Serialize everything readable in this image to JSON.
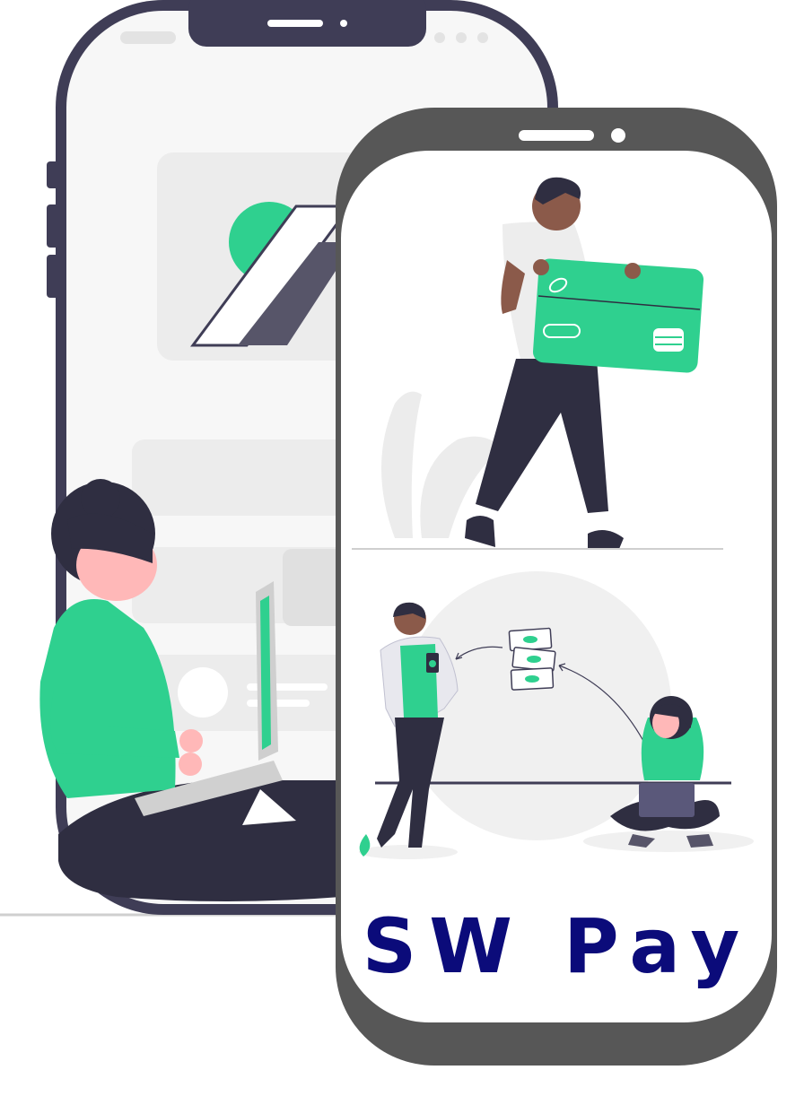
{
  "brand": {
    "text": "SW Pay",
    "color": "#0b0b7a"
  },
  "colors": {
    "accent_green": "#2fd08f",
    "phone_frame": "#575757",
    "back_phone_frame": "#3f3d56",
    "skin": "#8b5a4a"
  },
  "icons": [
    "phone-mockup",
    "credit-card-icon",
    "banknote-icon",
    "laptop-icon",
    "leaf-icon"
  ]
}
